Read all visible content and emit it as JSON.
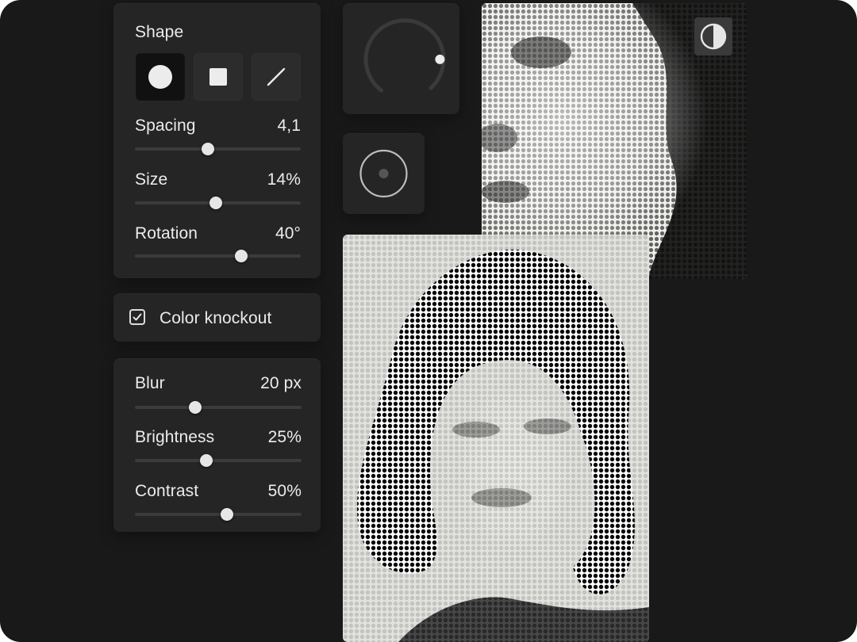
{
  "shape_panel": {
    "title": "Shape",
    "shapes": [
      {
        "icon": "circle-dot-icon",
        "active": true
      },
      {
        "icon": "square-dot-icon",
        "active": false
      },
      {
        "icon": "line-dot-icon",
        "active": false
      }
    ],
    "sliders": [
      {
        "label": "Spacing",
        "value": "4,1",
        "level": 0.44
      },
      {
        "label": "Size",
        "value": "14%",
        "level": 0.49
      },
      {
        "label": "Rotation",
        "value": "40°",
        "level": 0.64
      }
    ]
  },
  "knockout": {
    "label": "Color knockout",
    "checked": true
  },
  "adjust_panel": {
    "sliders": [
      {
        "label": "Blur",
        "value": "20 px",
        "level": 0.36
      },
      {
        "label": "Brightness",
        "value": "25%",
        "level": 0.43
      },
      {
        "label": "Contrast",
        "value": "50%",
        "level": 0.55
      }
    ]
  },
  "dial": {
    "level": 0.82
  },
  "icons": {
    "radial": "radial-target-icon",
    "contrast": "contrast-toggle-icon"
  },
  "colors": {
    "background": "#191919",
    "panel": "#252525",
    "text": "#ececec",
    "thumb": "#e6e6e6"
  }
}
